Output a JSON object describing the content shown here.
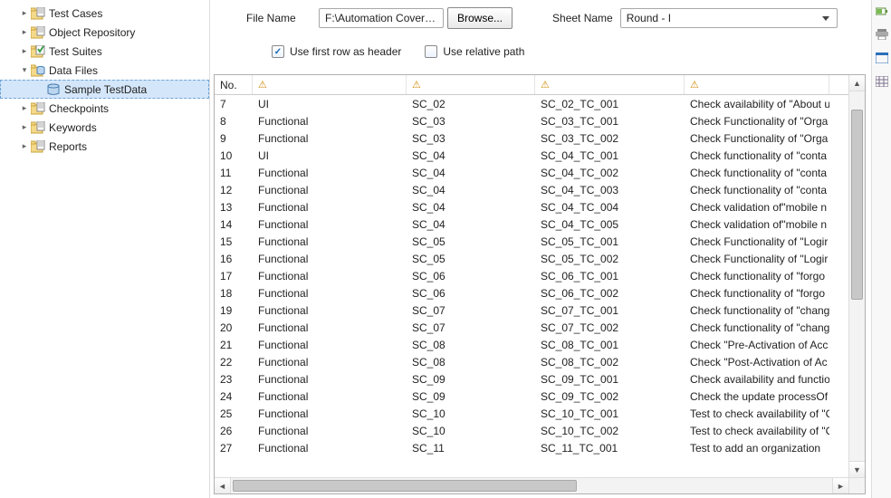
{
  "sidebar": {
    "items": [
      {
        "label": "Test Cases",
        "icon": "folder",
        "expanded": false,
        "level": 1
      },
      {
        "label": "Object Repository",
        "icon": "folder",
        "expanded": false,
        "level": 1
      },
      {
        "label": "Test Suites",
        "icon": "suite",
        "expanded": false,
        "level": 1
      },
      {
        "label": "Data Files",
        "icon": "datafiles",
        "expanded": true,
        "level": 1
      },
      {
        "label": "Sample TestData",
        "icon": "datafile",
        "expanded": false,
        "level": 2,
        "selected": true
      },
      {
        "label": "Checkpoints",
        "icon": "folder",
        "expanded": false,
        "level": 1
      },
      {
        "label": "Keywords",
        "icon": "folder",
        "expanded": false,
        "level": 1
      },
      {
        "label": "Reports",
        "icon": "folder",
        "expanded": false,
        "level": 1
      }
    ]
  },
  "toolbar": {
    "file_label": "File Name",
    "file_value": "F:\\Automation Coverage.x",
    "browse_label": "Browse...",
    "sheet_label": "Sheet Name",
    "sheet_value": "Round - I",
    "use_first_row_label": "Use first row as header",
    "use_first_row_checked": true,
    "use_relative_label": "Use relative path",
    "use_relative_checked": false
  },
  "grid": {
    "headers": [
      "No.",
      "",
      "",
      "",
      ""
    ],
    "rows": [
      {
        "no": "7",
        "c1": "UI",
        "c2": "SC_02",
        "c3": "SC_02_TC_001",
        "c4": "Check availability of \"About u"
      },
      {
        "no": "8",
        "c1": "Functional",
        "c2": "SC_03",
        "c3": "SC_03_TC_001",
        "c4": "Check Functionality of \"Orga"
      },
      {
        "no": "9",
        "c1": "Functional",
        "c2": "SC_03",
        "c3": "SC_03_TC_002",
        "c4": "Check Functionality of \"Orga"
      },
      {
        "no": "10",
        "c1": "UI",
        "c2": "SC_04",
        "c3": "SC_04_TC_001",
        "c4": "Check functionality of \"conta"
      },
      {
        "no": "11",
        "c1": "Functional",
        "c2": "SC_04",
        "c3": "SC_04_TC_002",
        "c4": "Check functionality of \"conta"
      },
      {
        "no": "12",
        "c1": "Functional",
        "c2": "SC_04",
        "c3": "SC_04_TC_003",
        "c4": "Check functionality of \"conta"
      },
      {
        "no": "13",
        "c1": "Functional",
        "c2": "SC_04",
        "c3": "SC_04_TC_004",
        "c4": "Check validation of\"mobile n"
      },
      {
        "no": "14",
        "c1": "Functional",
        "c2": "SC_04",
        "c3": "SC_04_TC_005",
        "c4": "Check validation of\"mobile n"
      },
      {
        "no": "15",
        "c1": "Functional",
        "c2": "SC_05",
        "c3": "SC_05_TC_001",
        "c4": "Check Functionality of \"Logir"
      },
      {
        "no": "16",
        "c1": "Functional",
        "c2": "SC_05",
        "c3": "SC_05_TC_002",
        "c4": "Check Functionality of \"Logir"
      },
      {
        "no": "17",
        "c1": "Functional",
        "c2": "SC_06",
        "c3": "SC_06_TC_001",
        "c4": "Check functionality of \"forgo"
      },
      {
        "no": "18",
        "c1": "Functional",
        "c2": "SC_06",
        "c3": "SC_06_TC_002",
        "c4": "Check functionality of \"forgo"
      },
      {
        "no": "19",
        "c1": "Functional",
        "c2": "SC_07",
        "c3": "SC_07_TC_001",
        "c4": "Check functionality of \"chang"
      },
      {
        "no": "20",
        "c1": "Functional",
        "c2": "SC_07",
        "c3": "SC_07_TC_002",
        "c4": "Check functionality of \"chang"
      },
      {
        "no": "21",
        "c1": "Functional",
        "c2": "SC_08",
        "c3": "SC_08_TC_001",
        "c4": "Check \"Pre-Activation of Acc"
      },
      {
        "no": "22",
        "c1": "Functional",
        "c2": "SC_08",
        "c3": "SC_08_TC_002",
        "c4": "Check \"Post-Activation of Ac"
      },
      {
        "no": "23",
        "c1": "Functional",
        "c2": "SC_09",
        "c3": "SC_09_TC_001",
        "c4": "Check availability and functio"
      },
      {
        "no": "24",
        "c1": "Functional",
        "c2": "SC_09",
        "c3": "SC_09_TC_002",
        "c4": "Check the update processOf "
      },
      {
        "no": "25",
        "c1": "Functional",
        "c2": "SC_10",
        "c3": "SC_10_TC_001",
        "c4": "Test to check availability of \"C"
      },
      {
        "no": "26",
        "c1": "Functional",
        "c2": "SC_10",
        "c3": "SC_10_TC_002",
        "c4": "Test to check availability of \"C"
      },
      {
        "no": "27",
        "c1": "Functional",
        "c2": "SC_11",
        "c3": "SC_11_TC_001",
        "c4": "Test to add an organization"
      }
    ]
  }
}
